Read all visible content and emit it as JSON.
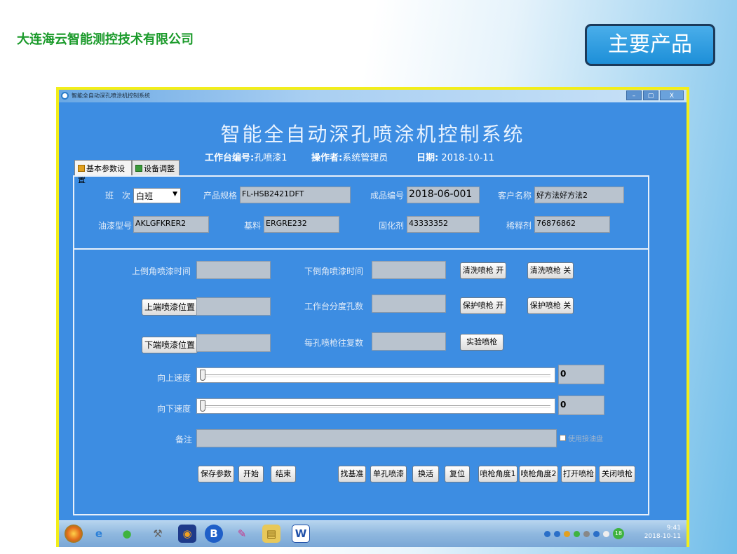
{
  "company": "大连海云智能测控技术有限公司",
  "main_products_label": "主要产品",
  "window": {
    "title": "智能全自动深孔喷涂机控制系统",
    "buttons": {
      "minimize": "–",
      "maximize": "▢",
      "close": "X"
    }
  },
  "system_title": "智能全自动深孔喷涂机控制系统",
  "info": {
    "station_label": "工作台编号:",
    "station_value": "孔喷漆1",
    "operator_label": "操作者:",
    "operator_value": "系统管理员",
    "date_label": "日期:",
    "date_value": "2018-10-11"
  },
  "tabs": [
    {
      "label": "基本参数设置"
    },
    {
      "label": "设备调整"
    }
  ],
  "params": {
    "shift_label": "班　次",
    "shift_value": "白班",
    "spec_label": "产品规格",
    "spec_value": "FL-HSB2421DFT",
    "product_no_label": "成品编号",
    "product_no_value": "2018-06-001",
    "customer_label": "客户名称",
    "customer_value": "好方法好方法2",
    "paint_label": "油漆型号",
    "paint_value": "AKLGFKRER2",
    "base_label": "基料",
    "base_value": "ERGRE232",
    "curing_label": "固化剂",
    "curing_value": "43333352",
    "thinner_label": "稀释剂",
    "thinner_value": "76876862"
  },
  "controls": {
    "upper_time_label": "上倒角喷漆时间",
    "upper_time_value": "",
    "lower_time_label": "下倒角喷漆时间",
    "lower_time_value": "",
    "upper_pos_button": "上端喷漆位置",
    "upper_pos_value": "",
    "index_holes_label": "工作台分度孔数",
    "index_holes_value": "",
    "lower_pos_button": "下端喷漆位置",
    "lower_pos_value": "",
    "repeat_label": "每孔喷枪往复数",
    "repeat_value": "",
    "clean_on": "清洗喷枪 开",
    "clean_off": "清洗喷枪 关",
    "protect_on": "保护喷枪 开",
    "protect_off": "保护喷枪 关",
    "test_gun": "实验喷枪",
    "up_speed_label": "向上速度",
    "up_speed_value": "0",
    "up_speed_level": 0,
    "down_speed_label": "向下速度",
    "down_speed_value": "0",
    "down_speed_level": 0,
    "remark_label": "备注",
    "remark_value": "",
    "tray_checkbox_label": "使用接油盘"
  },
  "actions": [
    "保存参数",
    "开始",
    "结束",
    "找基准",
    "单孔喷漆",
    "换活",
    "复位",
    "喷枪角度1",
    "喷枪角度2",
    "打开喷枪",
    "关闭喷枪"
  ],
  "taskbar": {
    "icons": [
      "start-orb-icon",
      "ie-icon",
      "wechat-icon",
      "tools-icon",
      "media-icon",
      "browser-icon",
      "paint-icon",
      "folder-icon",
      "word-icon"
    ],
    "time": "9:41",
    "date": "2018-10-11",
    "tray_badge": "18"
  }
}
